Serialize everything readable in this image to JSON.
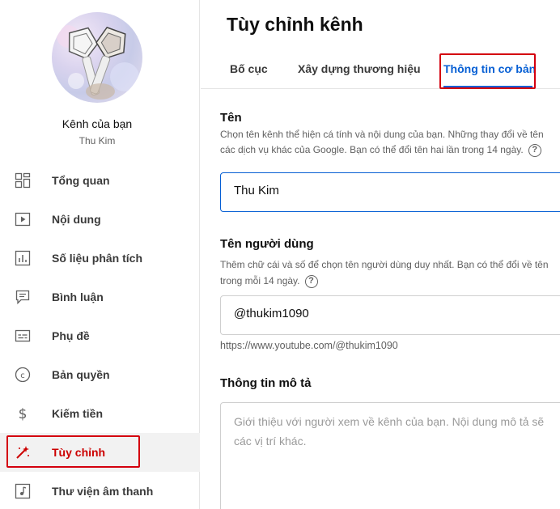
{
  "sidebar": {
    "channel_title": "Kênh của bạn",
    "channel_name": "Thu Kim",
    "items": [
      {
        "label": "Tổng quan",
        "icon": "dashboard-icon"
      },
      {
        "label": "Nội dung",
        "icon": "content-icon"
      },
      {
        "label": "Số liệu phân tích",
        "icon": "analytics-icon"
      },
      {
        "label": "Bình luận",
        "icon": "comments-icon"
      },
      {
        "label": "Phụ đề",
        "icon": "subtitles-icon"
      },
      {
        "label": "Bản quyền",
        "icon": "copyright-icon"
      },
      {
        "label": "Kiếm tiền",
        "icon": "monetization-icon"
      },
      {
        "label": "Tùy chỉnh",
        "icon": "customization-icon",
        "active": true
      },
      {
        "label": "Thư viện âm thanh",
        "icon": "audio-library-icon"
      }
    ]
  },
  "main": {
    "title": "Tùy chỉnh kênh",
    "tabs": [
      {
        "label": "Bố cục"
      },
      {
        "label": "Xây dựng thương hiệu"
      },
      {
        "label": "Thông tin cơ bản",
        "active": true
      }
    ],
    "name_section": {
      "title": "Tên",
      "desc_line1": "Chọn tên kênh thể hiện cá tính và nội dung của bạn. Những thay đổi về tên",
      "desc_line2": "các dịch vụ khác của Google. Bạn có thể đổi tên hai lần trong 14 ngày.",
      "value": "Thu Kim"
    },
    "handle_section": {
      "title": "Tên người dùng",
      "desc_line1": "Thêm chữ cái và số để chọn tên người dùng duy nhất. Bạn có thể đổi về tên",
      "desc_line2": "trong mỗi 14 ngày.",
      "value": "@thukim1090",
      "url": "https://www.youtube.com/@thukim1090"
    },
    "description_section": {
      "title": "Thông tin mô tả",
      "placeholder": "Giới thiệu với người xem về kênh của bạn. Nội dung mô tả sẽ\ncác vị trí khác."
    },
    "help_glyph": "?"
  },
  "colors": {
    "accent_red": "#cc0000",
    "highlight_box": "#d4000e",
    "tab_active": "#065fd4"
  }
}
